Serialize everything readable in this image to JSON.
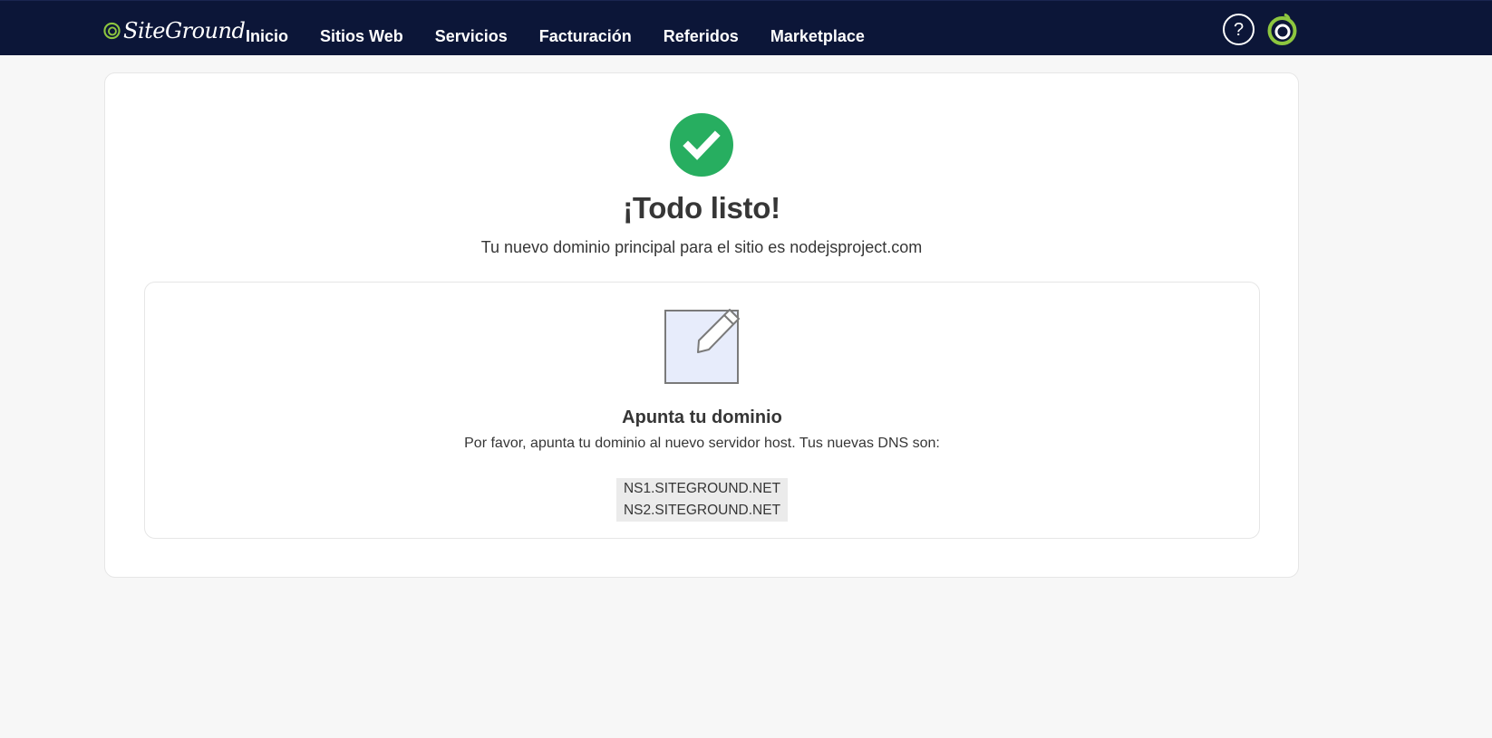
{
  "header": {
    "logo_text": "SiteGround",
    "nav": [
      {
        "label": "Inicio"
      },
      {
        "label": "Sitios Web"
      },
      {
        "label": "Servicios"
      },
      {
        "label": "Facturación"
      },
      {
        "label": "Referidos"
      },
      {
        "label": "Marketplace"
      }
    ],
    "help_icon": "?"
  },
  "colors": {
    "topbar": "#0c1638",
    "success": "#27ae60",
    "brand_green": "#8dc63f"
  },
  "icons": {
    "success": "check-circle-icon",
    "illustration": "edit-pencil-icon",
    "help": "question-circle-icon",
    "avatar": "siteground-avatar-icon"
  },
  "main": {
    "title": "¡Todo listo!",
    "subtitle": "Tu nuevo dominio principal para el sitio es nodejsproject.com",
    "point_domain": {
      "title": "Apunta tu dominio",
      "text": "Por favor, apunta tu dominio al nuevo servidor host. Tus nuevas DNS son:",
      "dns": [
        "NS1.SITEGROUND.NET",
        "NS2.SITEGROUND.NET"
      ]
    }
  }
}
